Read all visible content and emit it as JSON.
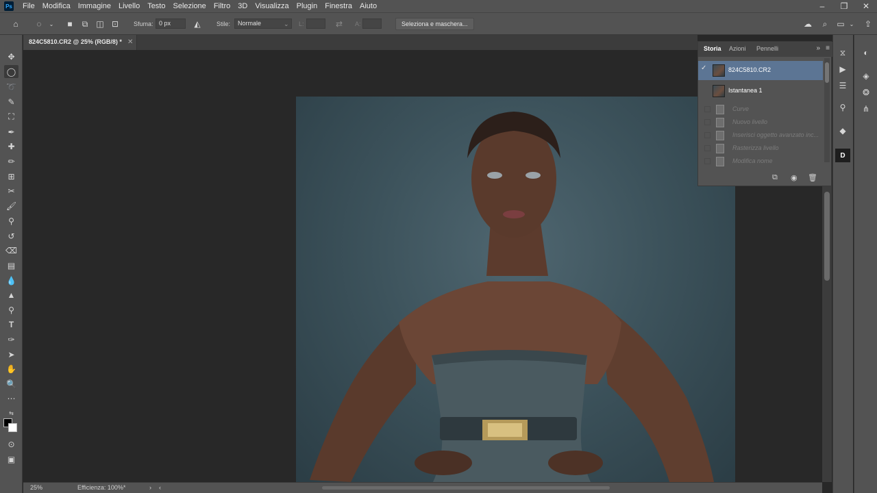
{
  "app": {
    "logo": "Ps"
  },
  "menu": [
    "File",
    "Modifica",
    "Immagine",
    "Livello",
    "Testo",
    "Selezione",
    "Filtro",
    "3D",
    "Visualizza",
    "Plugin",
    "Finestra",
    "Aiuto"
  ],
  "options": {
    "feather_label": "Sfuma:",
    "feather_value": "0 px",
    "style_label": "Stile:",
    "style_value": "Normale",
    "width_label": "L:",
    "height_label": "A:",
    "select_mask_label": "Seleziona e maschera..."
  },
  "document": {
    "tab_title": "824C5810.CR2 @ 25% (RGB/8) *"
  },
  "status": {
    "zoom": "25%",
    "efficiency": "Efficienza: 100%*"
  },
  "history_panel": {
    "tabs": [
      "Storia",
      "Azioni",
      "Pennelli"
    ],
    "active_tab": "Storia",
    "source": "824C5810.CR2",
    "snapshot": "Istantanea 1",
    "steps": [
      "Curve",
      "Nuovo livello",
      "Inserisci oggetto avanzato inc...",
      "Rasterizza livello",
      "Modifica nome"
    ]
  },
  "colors": {
    "selected_row": "#5c7594",
    "panel_bg": "#535353",
    "canvas_bg": "#282828"
  }
}
